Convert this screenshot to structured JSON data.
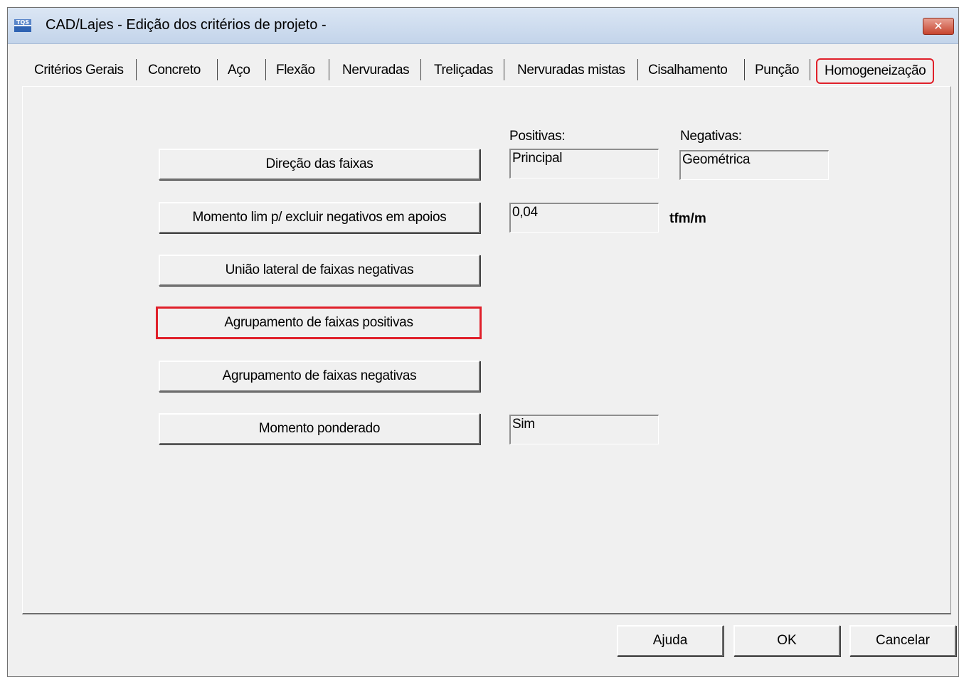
{
  "window": {
    "title": "CAD/Lajes - Edição dos critérios de projeto -",
    "icon_text": "TQS",
    "close_glyph": "✕"
  },
  "tabs": [
    {
      "label": "Critérios Gerais"
    },
    {
      "label": "Concreto"
    },
    {
      "label": "Aço"
    },
    {
      "label": "Flexão"
    },
    {
      "label": "Nervuradas"
    },
    {
      "label": "Treliçadas"
    },
    {
      "label": "Nervuradas mistas"
    },
    {
      "label": "Cisalhamento"
    },
    {
      "label": "Punção"
    },
    {
      "label": "Homogeneização",
      "active": true
    }
  ],
  "panel": {
    "positivas_label": "Positivas:",
    "negativas_label": "Negativas:",
    "buttons": [
      {
        "label": "Direção das faixas"
      },
      {
        "label": "Momento lim p/ excluir negativos em apoios"
      },
      {
        "label": "União lateral de faixas negativas"
      },
      {
        "label": "Agrupamento de faixas positivas",
        "highlighted": true
      },
      {
        "label": "Agrupamento de faixas negativas"
      },
      {
        "label": "Momento ponderado"
      }
    ],
    "direcao_positivas_value": "Principal",
    "direcao_negativas_value": "Geométrica",
    "momento_lim_value": "0,04",
    "momento_lim_unit": "tfm/m",
    "momento_ponderado_value": "Sim"
  },
  "footer": {
    "help_label": "Ajuda",
    "ok_label": "OK",
    "cancel_label": "Cancelar"
  },
  "colors": {
    "highlight": "#e0202a",
    "window_bg": "#f0f0f0"
  }
}
